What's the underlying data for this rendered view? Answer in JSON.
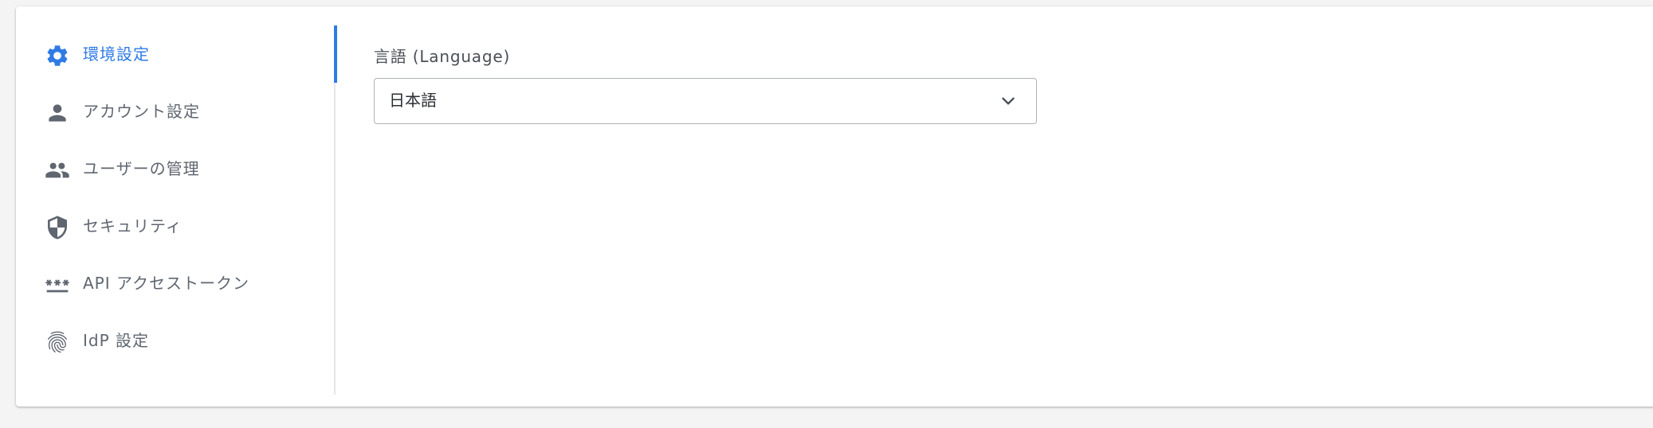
{
  "sidebar": {
    "items": [
      {
        "label": "環境設定",
        "icon": "gear-icon",
        "active": true
      },
      {
        "label": "アカウント設定",
        "icon": "person-icon",
        "active": false
      },
      {
        "label": "ユーザーの管理",
        "icon": "people-icon",
        "active": false
      },
      {
        "label": "セキュリティ",
        "icon": "shield-icon",
        "active": false
      },
      {
        "label": "API アクセストークン",
        "icon": "password-icon",
        "active": false
      },
      {
        "label": "IdP 設定",
        "icon": "fingerprint-icon",
        "active": false
      }
    ]
  },
  "main": {
    "language_field": {
      "label": "言語 (Language)",
      "value": "日本語",
      "icon": "chevron-down-icon"
    }
  },
  "colors": {
    "accent": "#2f7be5",
    "text": "#5f6670",
    "divider": "#e4e5e7",
    "background": "#f4f4f4"
  }
}
